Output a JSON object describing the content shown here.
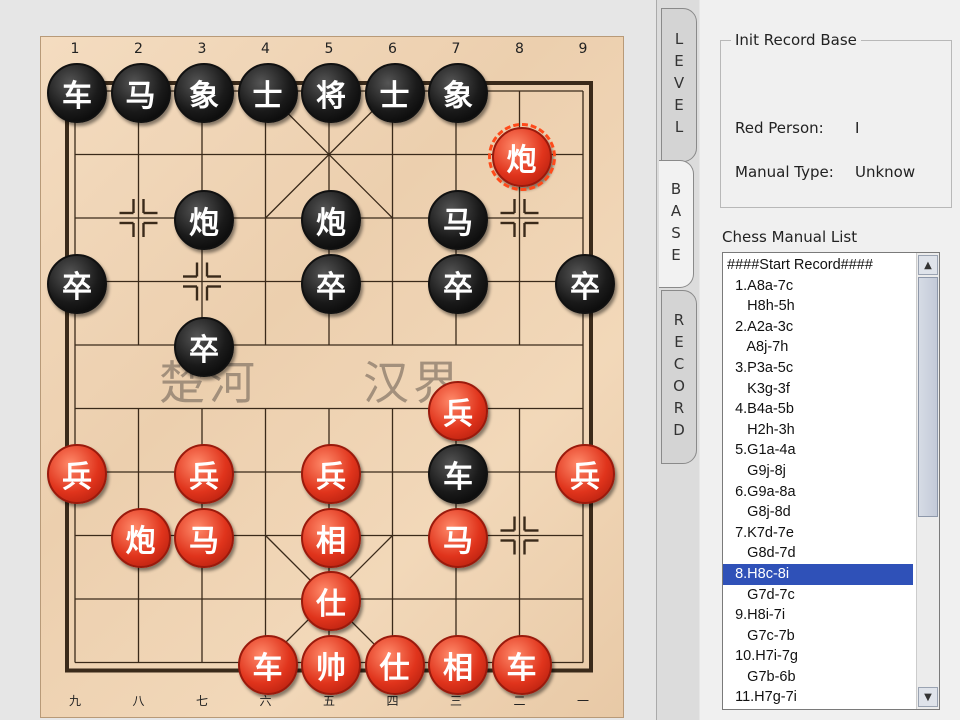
{
  "board": {
    "file_numbers_top": [
      "1",
      "2",
      "3",
      "4",
      "5",
      "6",
      "7",
      "8",
      "9"
    ],
    "file_numbers_bottom": [
      "九",
      "八",
      "七",
      "六",
      "五",
      "四",
      "三",
      "二",
      "一"
    ],
    "river_left": "楚河",
    "river_right": "汉界",
    "pieces": [
      {
        "name": "black-chariot",
        "label": "车",
        "color": "black",
        "file": 0,
        "rank": 0
      },
      {
        "name": "black-horse",
        "label": "马",
        "color": "black",
        "file": 1,
        "rank": 0
      },
      {
        "name": "black-elephant",
        "label": "象",
        "color": "black",
        "file": 2,
        "rank": 0
      },
      {
        "name": "black-advisor",
        "label": "士",
        "color": "black",
        "file": 3,
        "rank": 0
      },
      {
        "name": "black-general",
        "label": "将",
        "color": "black",
        "file": 4,
        "rank": 0
      },
      {
        "name": "black-advisor",
        "label": "士",
        "color": "black",
        "file": 5,
        "rank": 0
      },
      {
        "name": "black-elephant",
        "label": "象",
        "color": "black",
        "file": 6,
        "rank": 0
      },
      {
        "name": "red-cannon-selected",
        "label": "炮",
        "color": "red",
        "file": 7,
        "rank": 1,
        "selected": true
      },
      {
        "name": "black-cannon",
        "label": "炮",
        "color": "black",
        "file": 2,
        "rank": 2
      },
      {
        "name": "black-cannon",
        "label": "炮",
        "color": "black",
        "file": 4,
        "rank": 2
      },
      {
        "name": "black-horse",
        "label": "马",
        "color": "black",
        "file": 6,
        "rank": 2
      },
      {
        "name": "black-soldier",
        "label": "卒",
        "color": "black",
        "file": 0,
        "rank": 3
      },
      {
        "name": "black-soldier",
        "label": "卒",
        "color": "black",
        "file": 4,
        "rank": 3
      },
      {
        "name": "black-soldier",
        "label": "卒",
        "color": "black",
        "file": 6,
        "rank": 3
      },
      {
        "name": "black-soldier",
        "label": "卒",
        "color": "black",
        "file": 8,
        "rank": 3
      },
      {
        "name": "black-soldier",
        "label": "卒",
        "color": "black",
        "file": 2,
        "rank": 4
      },
      {
        "name": "red-soldier",
        "label": "兵",
        "color": "red",
        "file": 6,
        "rank": 5
      },
      {
        "name": "red-soldier",
        "label": "兵",
        "color": "red",
        "file": 0,
        "rank": 6
      },
      {
        "name": "red-soldier",
        "label": "兵",
        "color": "red",
        "file": 2,
        "rank": 6
      },
      {
        "name": "red-soldier",
        "label": "兵",
        "color": "red",
        "file": 4,
        "rank": 6
      },
      {
        "name": "black-chariot",
        "label": "车",
        "color": "black",
        "file": 6,
        "rank": 6
      },
      {
        "name": "red-soldier",
        "label": "兵",
        "color": "red",
        "file": 8,
        "rank": 6
      },
      {
        "name": "red-cannon",
        "label": "炮",
        "color": "red",
        "file": 1,
        "rank": 7
      },
      {
        "name": "red-horse",
        "label": "马",
        "color": "red",
        "file": 2,
        "rank": 7
      },
      {
        "name": "red-elephant",
        "label": "相",
        "color": "red",
        "file": 4,
        "rank": 7
      },
      {
        "name": "red-horse",
        "label": "马",
        "color": "red",
        "file": 6,
        "rank": 7
      },
      {
        "name": "red-advisor",
        "label": "仕",
        "color": "red",
        "file": 4,
        "rank": 8
      },
      {
        "name": "red-chariot",
        "label": "车",
        "color": "red",
        "file": 3,
        "rank": 9
      },
      {
        "name": "red-general",
        "label": "帅",
        "color": "red",
        "file": 4,
        "rank": 9
      },
      {
        "name": "red-advisor",
        "label": "仕",
        "color": "red",
        "file": 5,
        "rank": 9
      },
      {
        "name": "red-elephant",
        "label": "相",
        "color": "red",
        "file": 6,
        "rank": 9
      },
      {
        "name": "red-chariot",
        "label": "车",
        "color": "red",
        "file": 7,
        "rank": 9
      }
    ]
  },
  "tabs": {
    "level": "LEVEL",
    "base": "BASE",
    "record": "RECORD"
  },
  "info": {
    "group_title": "Init Record Base",
    "red_person_label": "Red Person:",
    "red_person_value": "I",
    "manual_type_label": "Manual Type:",
    "manual_type_value": "Unknow"
  },
  "manual_list": {
    "title": "Chess Manual List",
    "items": [
      "####Start Record####",
      "  1.A8a-7c",
      "     H8h-5h",
      "  2.A2a-3c",
      "     A8j-7h",
      "  3.P3a-5c",
      "     K3g-3f",
      "  4.B4a-5b",
      "     H2h-3h",
      "  5.G1a-4a",
      "     G9j-8j",
      "  6.G9a-8a",
      "     G8j-8d",
      "  7.K7d-7e",
      "     G8d-7d",
      "  8.H8c-8i",
      "     G7d-7c",
      "  9.H8i-7i",
      "     G7c-7b",
      "  10.H7i-7g",
      "     G7b-6b",
      "  11.H7g-7i"
    ],
    "selected_index": 15
  },
  "colors": {
    "board_line": "#3a2a1a",
    "list_selection": "#2f51b8"
  }
}
